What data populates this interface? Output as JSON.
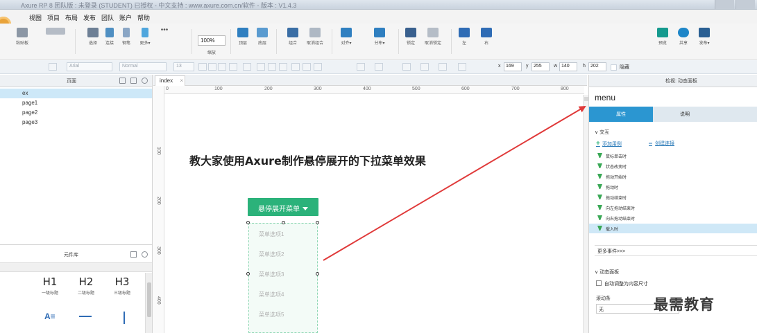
{
  "window": {
    "title": "Axure RP 8 团队版 : 未登录 (STUDENT) 已授权  - 中文支持 : www.axure.com.cn/软件 - 版本 : V1.4.3"
  },
  "menu": {
    "items": [
      "视图",
      "项目",
      "布局",
      "发布",
      "团队",
      "账户",
      "帮助"
    ]
  },
  "toolbar": {
    "clipboard_label": "粘贴板",
    "select_label": "选择",
    "connect_label": "连接",
    "pen_label": "钢笔",
    "more_label": "更多▾",
    "zoom_label": "缩放",
    "zoom_value": "100%",
    "top_label": "顶层",
    "bottom_label": "底层",
    "group_label": "组合",
    "ungroup_label": "取消组合",
    "align_label": "对齐▾",
    "distribute_label": "分布▾",
    "lock_label": "锁定",
    "unlock_label": "取消锁定",
    "left_label": "左",
    "right_label": "右",
    "preview_label": "预览",
    "share_label": "共享",
    "publish_label": "发布▾"
  },
  "formatbar": {
    "font_family": "Arial",
    "font_style": "Normal",
    "font_size": "13",
    "x_label": "x",
    "x_value": "169",
    "y_label": "y",
    "y_value": "255",
    "w_label": "w",
    "w_value": "140",
    "h_label": "h",
    "h_value": "202",
    "hidden_label": "隐藏"
  },
  "pages_panel": {
    "title": "页面",
    "pages": [
      {
        "name": "ex",
        "selected": true
      },
      {
        "name": "page1",
        "selected": false
      },
      {
        "name": "page2",
        "selected": false
      },
      {
        "name": "page3",
        "selected": false
      }
    ]
  },
  "library_panel": {
    "title": "元件库",
    "headings": [
      {
        "big": "H1",
        "small": "一级标题"
      },
      {
        "big": "H2",
        "small": "二级标题"
      },
      {
        "big": "H3",
        "small": "三级标题"
      }
    ]
  },
  "canvas": {
    "tab_label": "index",
    "ruler_h": [
      "0",
      "100",
      "200",
      "300",
      "400",
      "500",
      "600",
      "700",
      "800"
    ],
    "ruler_v": [
      "100",
      "200",
      "300",
      "400"
    ],
    "main_title": "教大家使用Axure制作悬停展开的下拉菜单效果",
    "dropdown_button": "悬停展开菜单",
    "menu_options": [
      "菜单选项1",
      "菜单选项2",
      "菜单选项3",
      "菜单选项4",
      "菜单选项5"
    ]
  },
  "inspector": {
    "header": "检视: 动态面板",
    "widget_name": "menu",
    "tabs": [
      "属性",
      "说明"
    ],
    "interaction_section": "∨ 交互",
    "add_case": "添加用例",
    "create_link": "创建连接",
    "events": [
      {
        "label": "鼠标单击时",
        "selected": false
      },
      {
        "label": "状态改变时",
        "selected": false
      },
      {
        "label": "拖动开始时",
        "selected": false
      },
      {
        "label": "拖动时",
        "selected": false
      },
      {
        "label": "拖动结束时",
        "selected": false
      },
      {
        "label": "向左拖动结束时",
        "selected": false
      },
      {
        "label": "向右拖动结束时",
        "selected": false
      },
      {
        "label": "载入时",
        "selected": true
      }
    ],
    "more_events": "更多事件>>>",
    "dynpanel_section": "∨ 动态面板",
    "auto_resize": "自动调整为内容尺寸",
    "scrollbar_label": "滚动条",
    "scrollbar_value": "无"
  },
  "watermark": "最需教育",
  "colors": {
    "accent_green": "#2bb27a",
    "tab_blue": "#2b96d1",
    "arrow_red": "#e03a3a"
  }
}
